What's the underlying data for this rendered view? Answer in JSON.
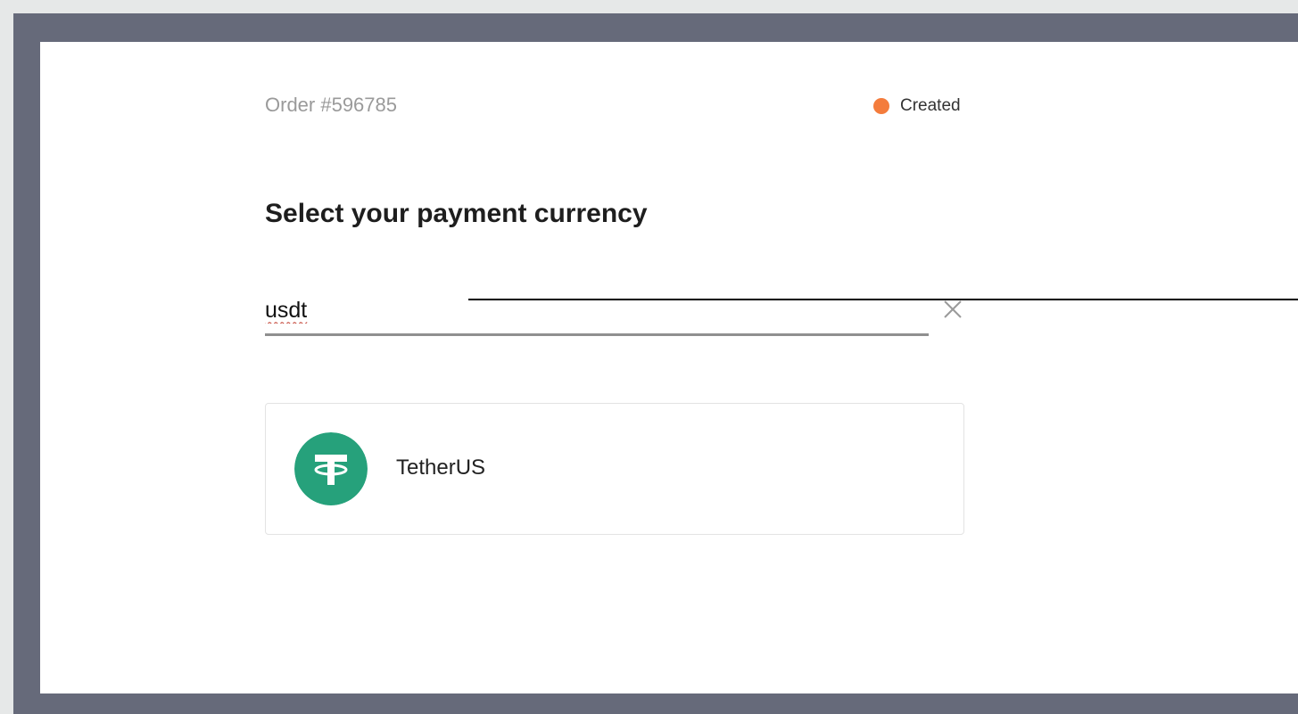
{
  "order": {
    "label": "Order #596785"
  },
  "status": {
    "label": "Created",
    "color": "#f47c3c"
  },
  "heading": {
    "text": "Select your payment currency"
  },
  "search": {
    "value": "usdt",
    "clear_icon": "close-icon"
  },
  "results": [
    {
      "name": "TetherUS",
      "icon": "tether-icon",
      "color": "#26a17b"
    }
  ]
}
